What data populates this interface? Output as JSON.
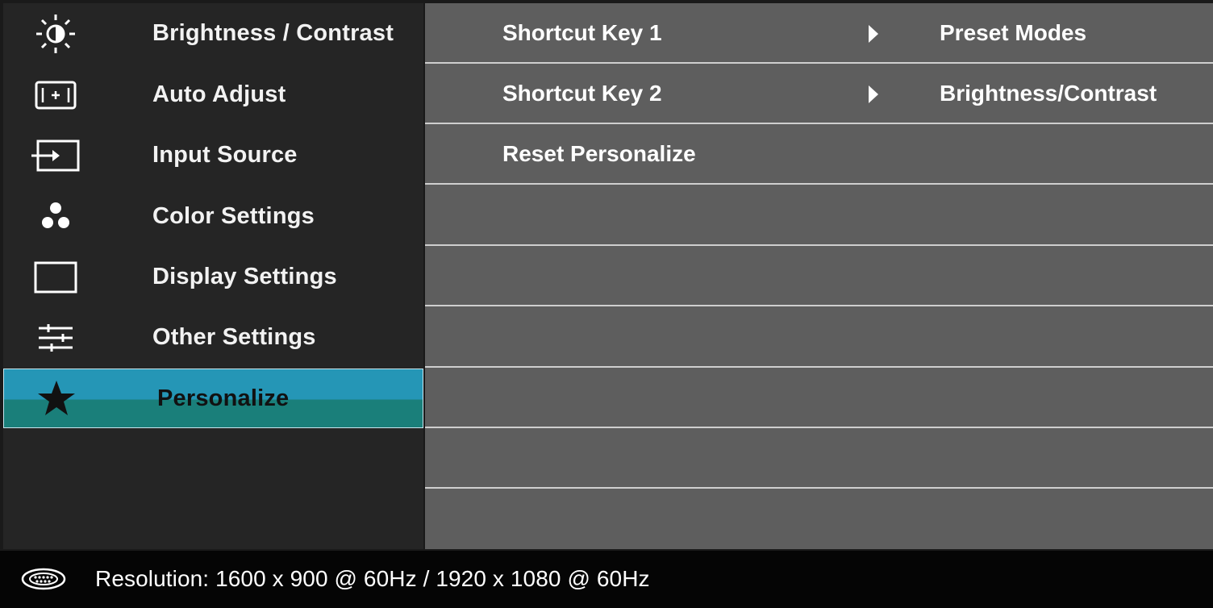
{
  "menu": {
    "items": [
      {
        "label": "Brightness / Contrast",
        "icon": "brightness-icon"
      },
      {
        "label": "Auto Adjust",
        "icon": "auto-adjust-icon"
      },
      {
        "label": "Input Source",
        "icon": "input-source-icon"
      },
      {
        "label": "Color Settings",
        "icon": "color-settings-icon"
      },
      {
        "label": "Display Settings",
        "icon": "display-settings-icon"
      },
      {
        "label": "Other Settings",
        "icon": "other-settings-icon"
      },
      {
        "label": "Personalize",
        "icon": "star-icon",
        "selected": true
      }
    ]
  },
  "submenu": {
    "rows": [
      {
        "label": "Shortcut Key 1",
        "value": "Preset Modes"
      },
      {
        "label": "Shortcut Key 2",
        "value": "Brightness/Contrast"
      },
      {
        "label": "Reset Personalize"
      }
    ]
  },
  "status": {
    "icon": "vga-connector-icon",
    "resolution_label": "Resolution:",
    "resolution_value": "1600 x 900 @ 60Hz / 1920 x 1080 @ 60Hz"
  },
  "colors": {
    "selected_top": "#2596b6",
    "selected_bottom": "#1a7f7a",
    "submenu_bg": "#5e5e5e",
    "sidebar_bg": "#252525"
  }
}
